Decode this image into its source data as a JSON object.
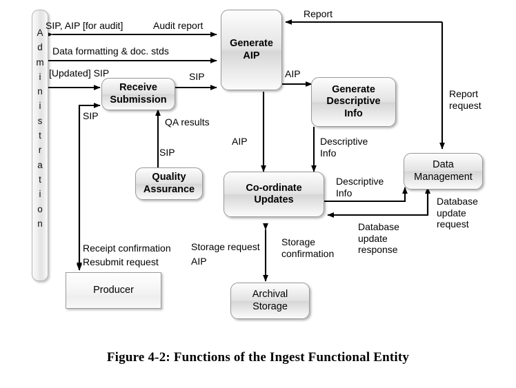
{
  "figure": {
    "caption": "Figure 4-2:  Functions of the Ingest Functional Entity"
  },
  "admin": {
    "label": "Administration",
    "letters": [
      "A",
      "d",
      "m",
      "i",
      "n",
      "i",
      "s",
      "t",
      "r",
      "a",
      "t",
      "i",
      "o",
      "n"
    ]
  },
  "nodes": [
    {
      "id": "receive-submission",
      "label": "Receive\nSubmission",
      "kind": "process"
    },
    {
      "id": "generate-aip",
      "label": "Generate\nAIP",
      "kind": "process"
    },
    {
      "id": "generate-descriptive",
      "label": "Generate\nDescriptive\nInfo",
      "kind": "process"
    },
    {
      "id": "quality-assurance",
      "label": "Quality\nAssurance",
      "kind": "process"
    },
    {
      "id": "coordinate-updates",
      "label": "Co-ordinate\nUpdates",
      "kind": "process"
    },
    {
      "id": "data-management",
      "label": "Data\nManagement",
      "kind": "entity"
    },
    {
      "id": "archival-storage",
      "label": "Archival\nStorage",
      "kind": "entity"
    },
    {
      "id": "producer",
      "label": "Producer",
      "kind": "plain"
    }
  ],
  "edge_labels": {
    "sip_aip_audit": "SIP, AIP [for audit]",
    "audit_report": "Audit report",
    "data_formatting": "Data formatting & doc. stds",
    "updated_sip": "[Updated] SIP",
    "sip_to_generate": "SIP",
    "report": "Report",
    "aip_to_descriptive": "AIP",
    "report_request": "Report\nrequest",
    "sip_from_producer": "SIP",
    "qa_results": "QA results",
    "sip_to_qa": "SIP",
    "aip_to_coordinate": "AIP",
    "descriptive_info_down": "Descriptive\nInfo",
    "descriptive_info_right": "Descriptive\nInfo",
    "database_update_request": "Database\nupdate\nrequest",
    "database_update_response": "Database\nupdate\nresponse",
    "receipt_confirmation": "Receipt confirmation",
    "resubmit_request": "Resubmit request",
    "storage_request": "Storage request",
    "storage_request_aip": "AIP",
    "storage_confirmation": "Storage\nconfirmation"
  },
  "colors": {
    "background": "#ffffff",
    "stroke": "#000000",
    "box_border": "#9a9a9a",
    "text": "#000000"
  }
}
